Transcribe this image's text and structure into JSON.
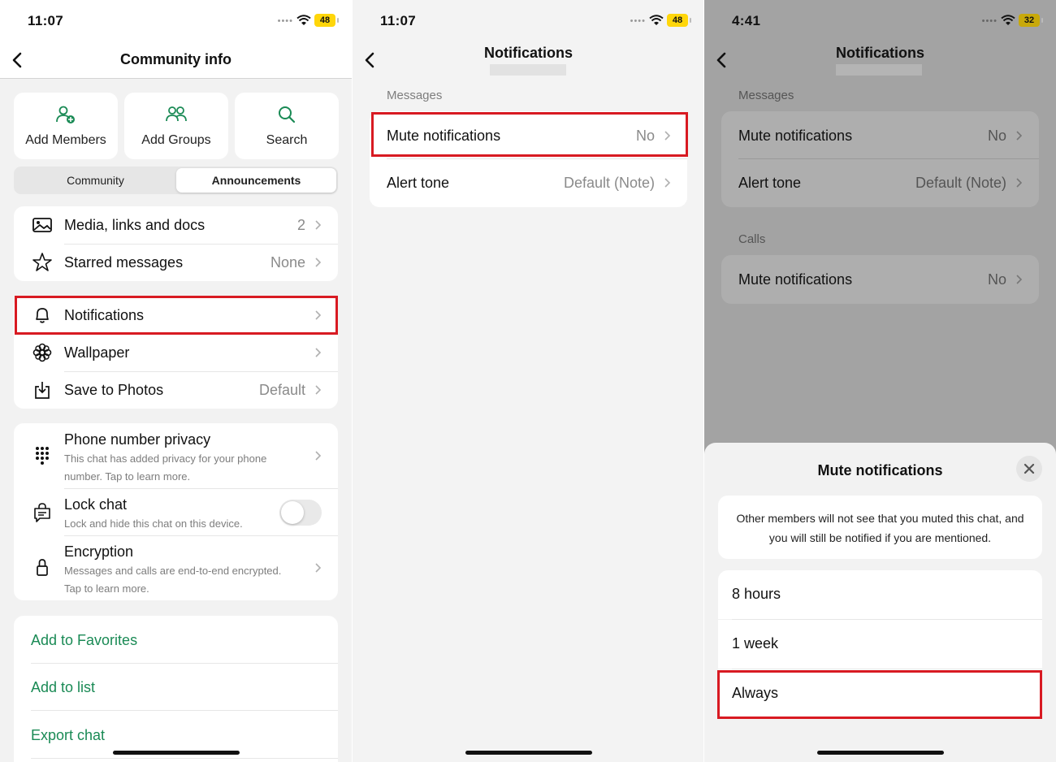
{
  "panel1": {
    "status": {
      "time": "11:07",
      "battery": "48"
    },
    "title": "Community info",
    "actions": [
      {
        "label": "Add Members",
        "icon": "add-member-icon"
      },
      {
        "label": "Add Groups",
        "icon": "add-group-icon"
      },
      {
        "label": "Search",
        "icon": "search-icon"
      }
    ],
    "segment": {
      "options": [
        "Community",
        "Announcements"
      ],
      "selected": "Announcements"
    },
    "group1": [
      {
        "label": "Media, links and docs",
        "value": "2",
        "icon": "media-icon"
      },
      {
        "label": "Starred messages",
        "value": "None",
        "icon": "star-icon"
      }
    ],
    "group2": [
      {
        "label": "Notifications",
        "value": "",
        "icon": "bell-icon"
      },
      {
        "label": "Wallpaper",
        "value": "",
        "icon": "wallpaper-icon"
      },
      {
        "label": "Save to Photos",
        "value": "Default",
        "icon": "save-photos-icon"
      }
    ],
    "group3": [
      {
        "label": "Phone number privacy",
        "sub1": "This chat has added privacy for your phone",
        "sub2": "number. Tap to learn more.",
        "icon": "dialpad-icon"
      },
      {
        "label": "Lock chat",
        "sub1": "Lock and hide this chat on this device.",
        "icon": "lock-chat-icon",
        "toggle": false
      },
      {
        "label": "Encryption",
        "sub1": "Messages and calls are end-to-end encrypted.",
        "sub2": "Tap to learn more.",
        "icon": "lock-icon"
      }
    ],
    "links": [
      "Add to Favorites",
      "Add to list",
      "Export chat"
    ],
    "accent_color": "#1a8a55",
    "highlight_color": "#d81a22"
  },
  "panel2": {
    "status": {
      "time": "11:07",
      "battery": "48"
    },
    "title": "Notifications",
    "section": "Messages",
    "rows": [
      {
        "label": "Mute notifications",
        "value": "No"
      },
      {
        "label": "Alert tone",
        "value": "Default (Note)"
      }
    ]
  },
  "panel3": {
    "status": {
      "time": "4:41",
      "battery": "32"
    },
    "title": "Notifications",
    "messages_section": "Messages",
    "messages_rows": [
      {
        "label": "Mute notifications",
        "value": "No"
      },
      {
        "label": "Alert tone",
        "value": "Default (Note)"
      }
    ],
    "calls_section": "Calls",
    "calls_rows": [
      {
        "label": "Mute notifications",
        "value": "No"
      }
    ],
    "sheet": {
      "title": "Mute notifications",
      "info_line1": "Other members will not see that you muted this chat, and",
      "info_line2": "you will still be notified if you are mentioned.",
      "options": [
        "8 hours",
        "1 week",
        "Always"
      ]
    }
  }
}
